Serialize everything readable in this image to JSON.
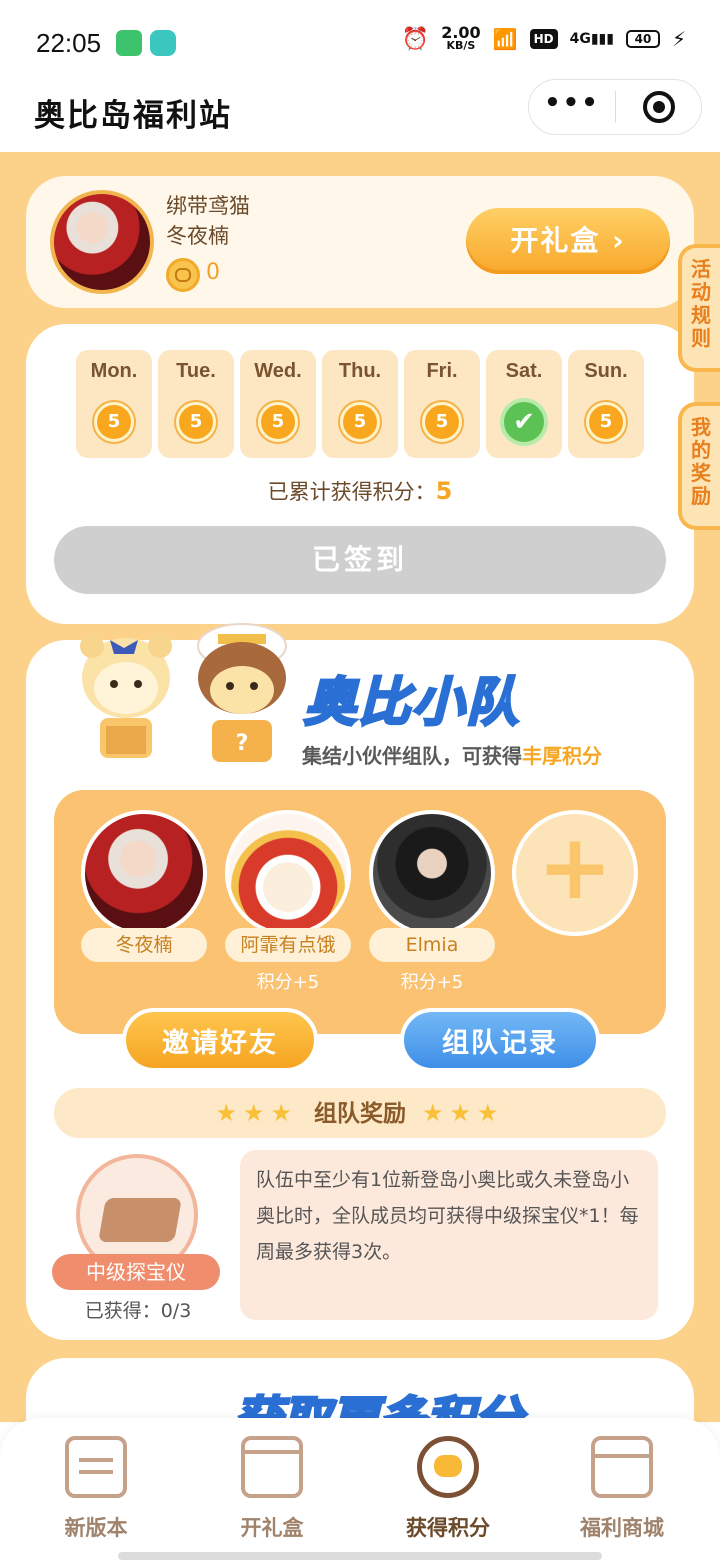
{
  "status_bar": {
    "time": "22:05",
    "speed_value": "2.00",
    "speed_unit": "KB/S",
    "hd": "HD",
    "network": "4G",
    "battery": "40"
  },
  "header": {
    "title": "奥比岛福利站",
    "more": "•••"
  },
  "profile": {
    "name": "绑带鸢猫",
    "subtitle": "冬夜楠",
    "coins": "0",
    "open_gift_label": "开礼盒 ›"
  },
  "side_tabs": {
    "rules": "活动规则",
    "my_rewards": "我的奖励"
  },
  "sign_in": {
    "days": [
      {
        "label": "Mon.",
        "value": "5",
        "checked": false
      },
      {
        "label": "Tue.",
        "value": "5",
        "checked": false
      },
      {
        "label": "Wed.",
        "value": "5",
        "checked": false
      },
      {
        "label": "Thu.",
        "value": "5",
        "checked": false
      },
      {
        "label": "Fri.",
        "value": "5",
        "checked": false
      },
      {
        "label": "Sat.",
        "value": "✔",
        "checked": true
      },
      {
        "label": "Sun.",
        "value": "5",
        "checked": false
      }
    ],
    "points_label": "已累计获得积分：",
    "points_value": "5",
    "button_label": "已签到"
  },
  "team": {
    "title": "奥比小队",
    "subtitle_prefix": "集结小伙伴组队，可获得",
    "subtitle_highlight": "丰厚积分",
    "members": [
      {
        "name": "冬夜楠",
        "points": ""
      },
      {
        "name": "阿霏有点饿",
        "points": "积分+5"
      },
      {
        "name": "Elmia",
        "points": "积分+5"
      }
    ],
    "add_symbol": "+",
    "invite_label": "邀请好友",
    "record_label": "组队记录",
    "reward_title": "组队奖励",
    "reward_stars": "★★★",
    "item_name": "中级探宝仪",
    "item_obtained": "已获得：0/3",
    "description": "队伍中至少有1位新登岛小奥比或久未登岛小奥比时，全队成员均可获得中级探宝仪*1！每周最多获得3次。"
  },
  "next_section": {
    "title": "获取更多积分"
  },
  "tabbar": {
    "items": [
      {
        "label": "新版本",
        "icon": "calendar-icon"
      },
      {
        "label": "开礼盒",
        "icon": "gift-box-icon"
      },
      {
        "label": "获得积分",
        "icon": "bear-coin-icon"
      },
      {
        "label": "福利商城",
        "icon": "shop-icon"
      }
    ],
    "active_index": 2
  },
  "colors": {
    "bg": "#fcd28a",
    "accent": "#f6a623",
    "blue": "#4a9bea"
  }
}
